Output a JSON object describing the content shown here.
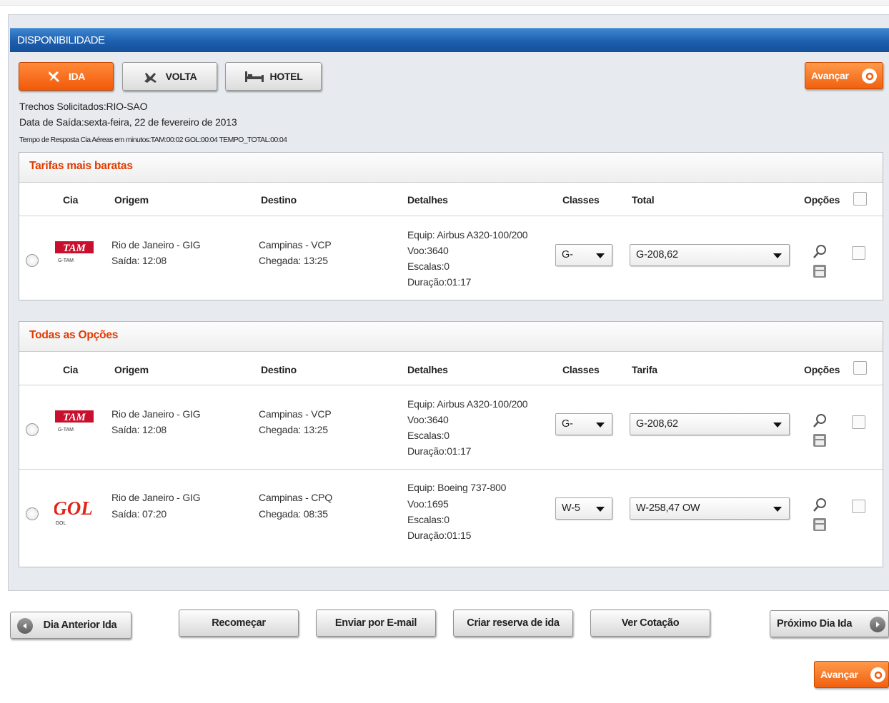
{
  "header": {
    "title": "DISPONIBILIDADE"
  },
  "tabs": [
    {
      "label": "IDA",
      "icon": "plane-takeoff-icon",
      "active": true
    },
    {
      "label": "VOLTA",
      "icon": "plane-landing-icon",
      "active": false
    },
    {
      "label": "HOTEL",
      "icon": "bed-icon",
      "active": false
    }
  ],
  "avancar_label": "Avançar",
  "info": {
    "trechos": "Trechos Solicitados:RIO-SAO",
    "data_saida": "Data de Saída:sexta-feira, 22 de fevereiro de 2013",
    "tempo_resposta": "Tempo de Resposta Cia Aéreas em minutos:TAM:00:02 GOL:00:04 TEMPO_TOTAL:00:04"
  },
  "cheapest": {
    "title": "Tarifas mais baratas",
    "columns": {
      "cia": "Cia",
      "origem": "Origem",
      "destino": "Destino",
      "detalhes": "Detalhes",
      "classes": "Classes",
      "total": "Total",
      "opcoes": "Opções"
    },
    "rows": [
      {
        "airline": "TAM",
        "airline_code": "G-TAM",
        "origem": "Rio de Janeiro - GIG",
        "saida": "Saída: 12:08",
        "destino": "Campinas - VCP",
        "chegada": "Chegada: 13:25",
        "equip": "Equip: Airbus A320-100/200",
        "voo": "Voo:3640",
        "escalas": "Escalas:0",
        "duracao": "Duração:01:17",
        "classe": "G-",
        "tarifa": "G-208,62"
      }
    ]
  },
  "all_options": {
    "title": "Todas as Opções",
    "columns": {
      "cia": "Cia",
      "origem": "Origem",
      "destino": "Destino",
      "detalhes": "Detalhes",
      "classes": "Classes",
      "tarifa": "Tarifa",
      "opcoes": "Opções"
    },
    "rows": [
      {
        "airline": "TAM",
        "airline_code": "G-TAM",
        "origem": "Rio de Janeiro - GIG",
        "saida": "Saída: 12:08",
        "destino": "Campinas - VCP",
        "chegada": "Chegada: 13:25",
        "equip": "Equip: Airbus A320-100/200",
        "voo": "Voo:3640",
        "escalas": "Escalas:0",
        "duracao": "Duração:01:17",
        "classe": "G-",
        "tarifa": "G-208,62"
      },
      {
        "airline": "GOL",
        "airline_code": "GOL",
        "origem": "Rio de Janeiro - GIG",
        "saida": "Saída: 07:20",
        "destino": "Campinas - CPQ",
        "chegada": "Chegada: 08:35",
        "equip": "Equip: Boeing 737-800",
        "voo": "Voo:1695",
        "escalas": "Escalas:0",
        "duracao": "Duração:01:15",
        "classe": "W-5",
        "tarifa": "W-258,47 OW"
      }
    ]
  },
  "bottom": {
    "dia_anterior": "Dia Anterior Ida",
    "recomecar": "Recomeçar",
    "enviar_email": "Enviar por E-mail",
    "criar_reserva": "Criar reserva de ida",
    "ver_cotacao": "Ver Cotação",
    "proximo_dia": "Próximo Dia Ida"
  },
  "colors": {
    "accent_orange": "#f15a0a",
    "header_blue": "#1d5fae",
    "section_title_red": "#e03a00",
    "tam_red": "#c8102e",
    "gol_red": "#e2231a"
  }
}
